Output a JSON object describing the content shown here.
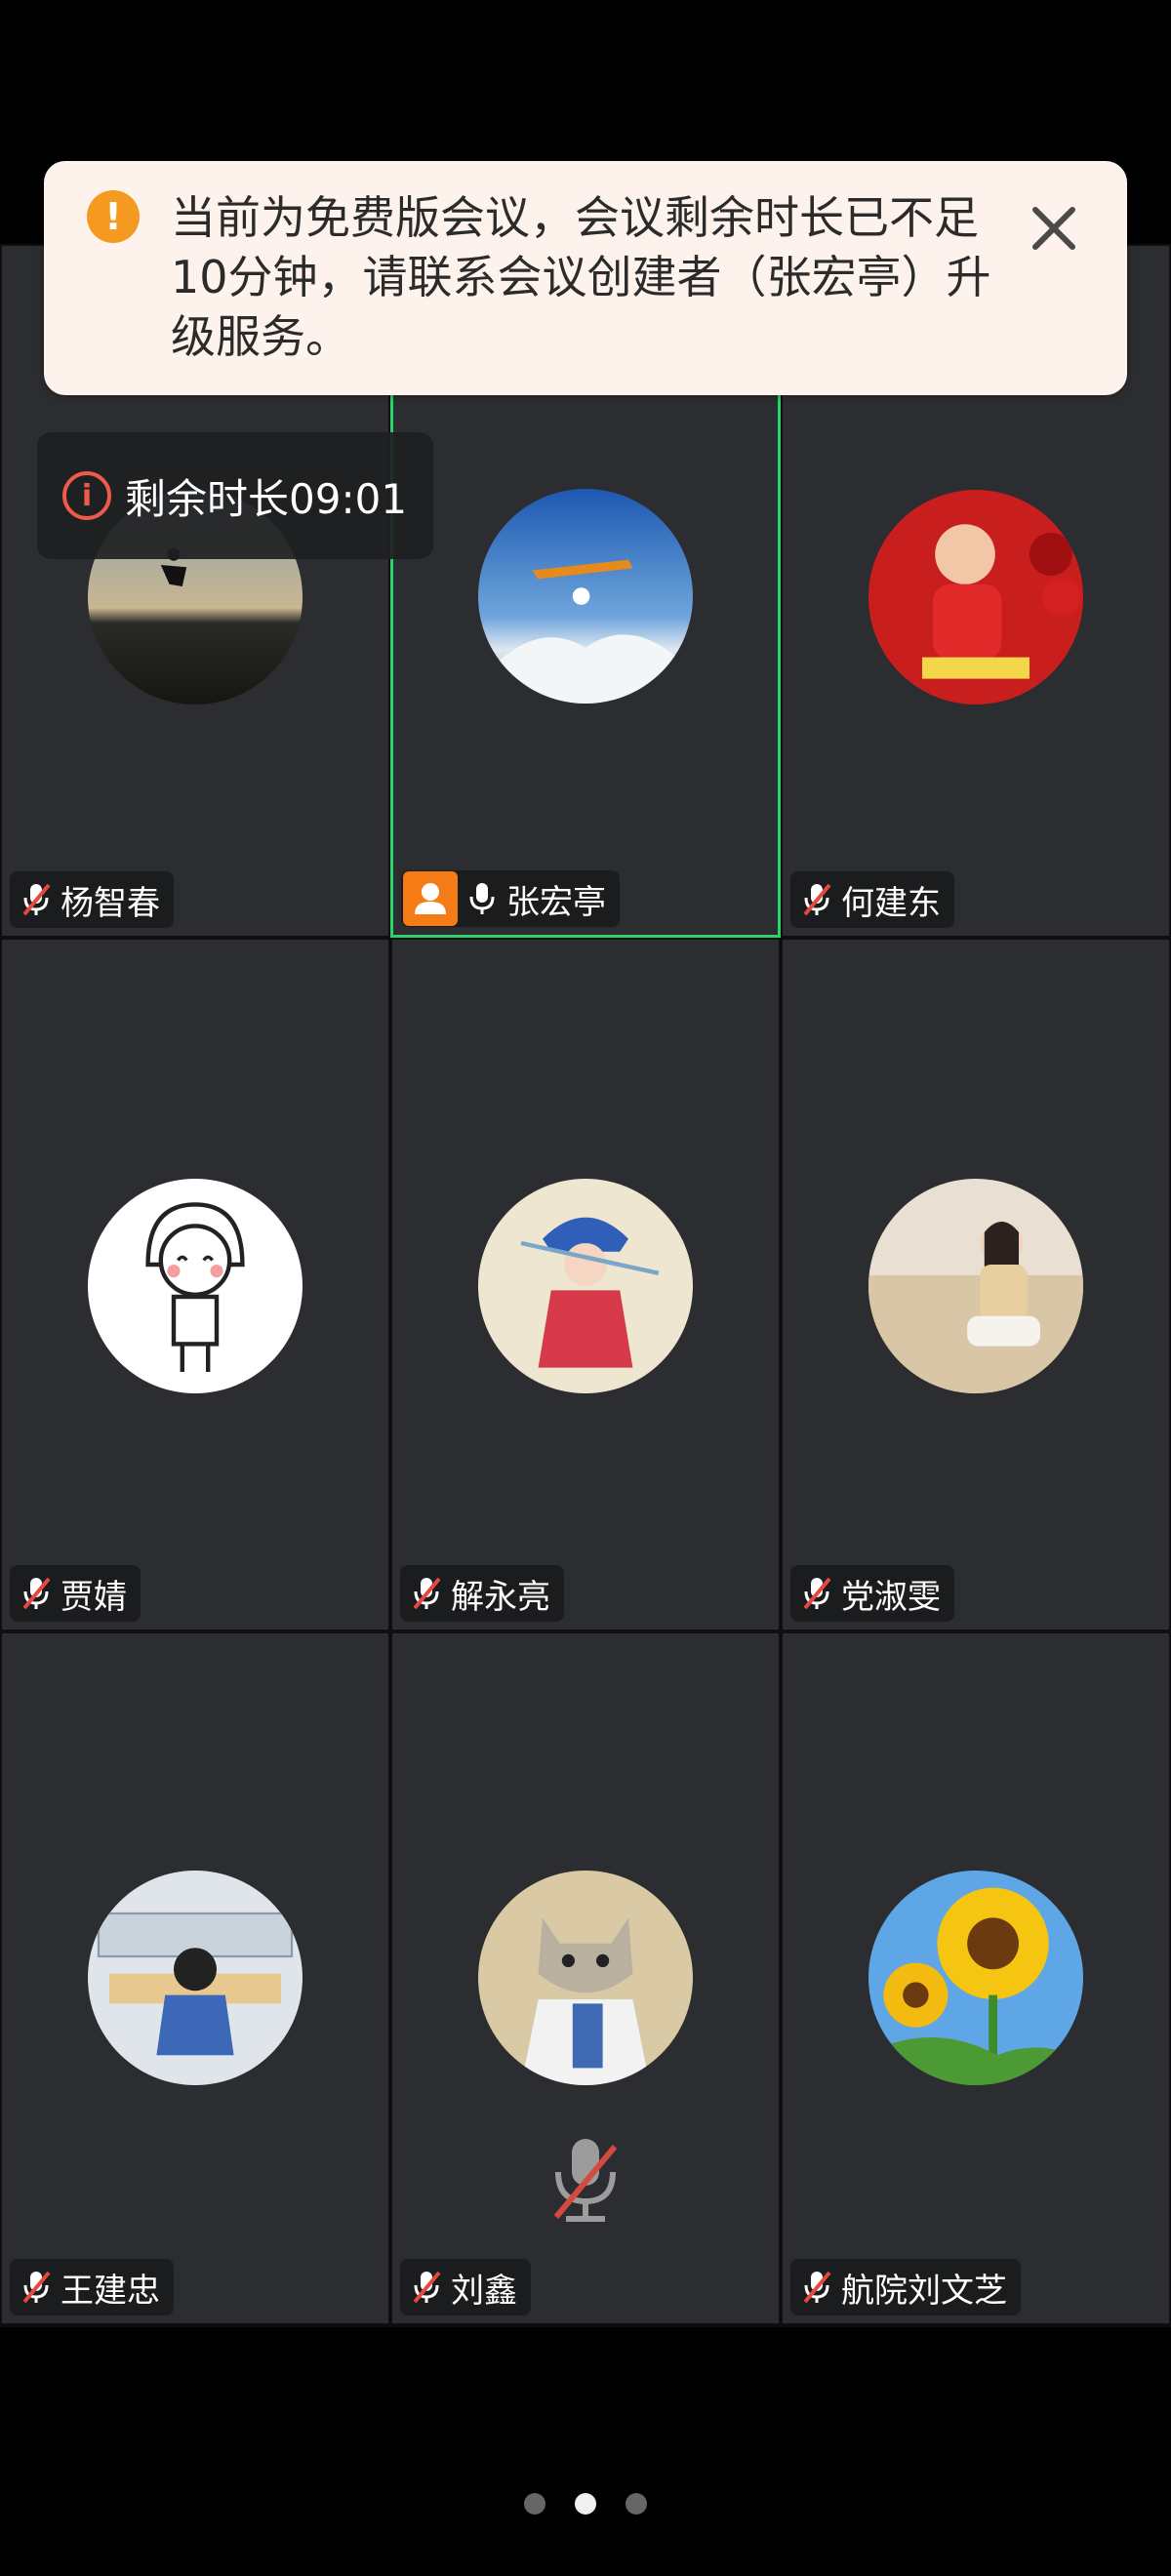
{
  "banner": {
    "message": "当前为免费版会议，会议剩余时长已不足10分钟，请联系会议创建者（张宏亭）升级服务。",
    "icon": "warning-icon",
    "close_icon": "close-icon"
  },
  "timer": {
    "text": "剩余时长09:01",
    "icon": "info-icon"
  },
  "participants": [
    {
      "name": "杨智春",
      "muted": true
    },
    {
      "name": "张宏亭",
      "muted": false,
      "host": true,
      "active": true
    },
    {
      "name": "何建东",
      "muted": true
    },
    {
      "name": "贾婧",
      "muted": true
    },
    {
      "name": "解永亮",
      "muted": true
    },
    {
      "name": "党淑雯",
      "muted": true
    },
    {
      "name": "王建忠",
      "muted": true
    },
    {
      "name": "刘鑫",
      "muted": true
    },
    {
      "name": "航院刘文芝",
      "muted": true
    }
  ],
  "pager": {
    "pages": 3,
    "current": 2
  },
  "colors": {
    "accent_active": "#2bd46a",
    "host_badge": "#f47b16",
    "muted_slash": "#e5483f"
  }
}
